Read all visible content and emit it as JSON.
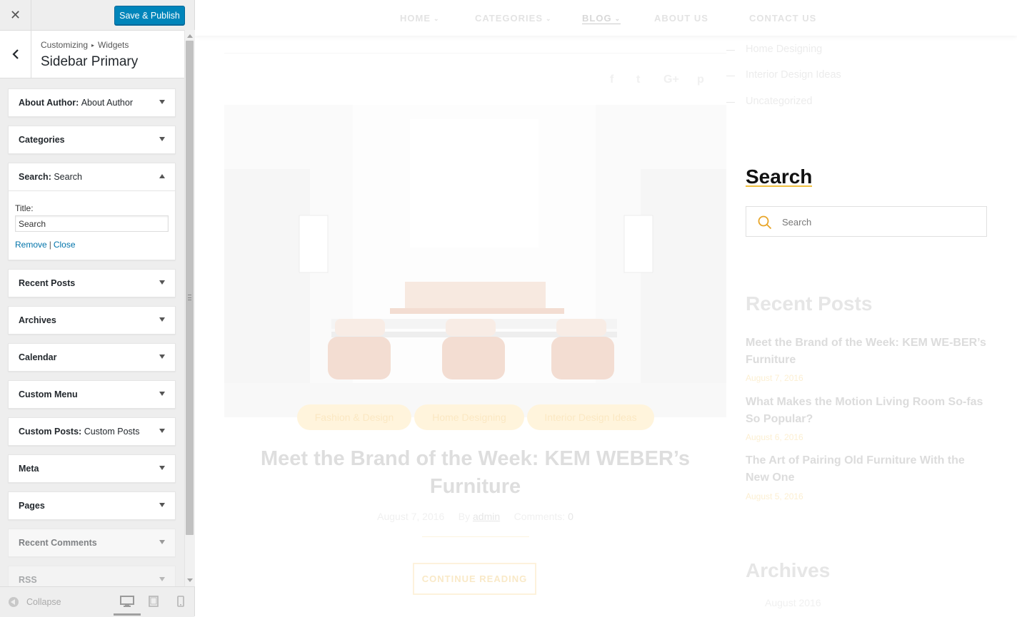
{
  "customizer": {
    "close_label": "✕",
    "save_label": "Save & Publish",
    "breadcrumb": {
      "first": "Customizing",
      "second": "Widgets"
    },
    "section_title": "Sidebar Primary",
    "widgets": [
      {
        "name": "About Author",
        "subtitle": "About Author"
      },
      {
        "name": "Categories",
        "subtitle": ""
      },
      {
        "name": "Search",
        "subtitle": "Search"
      },
      {
        "name": "Recent Posts",
        "subtitle": ""
      },
      {
        "name": "Archives",
        "subtitle": ""
      },
      {
        "name": "Calendar",
        "subtitle": ""
      },
      {
        "name": "Custom Menu",
        "subtitle": ""
      },
      {
        "name": "Custom Posts",
        "subtitle": "Custom Posts"
      },
      {
        "name": "Meta",
        "subtitle": ""
      },
      {
        "name": "Pages",
        "subtitle": ""
      },
      {
        "name": "Recent Comments",
        "subtitle": ""
      },
      {
        "name": "RSS",
        "subtitle": ""
      }
    ],
    "search_form": {
      "title_label": "Title:",
      "title_value": "Search",
      "remove_label": "Remove",
      "separator": "|",
      "close_label": "Close"
    },
    "footer": {
      "collapse_label": "Collapse"
    },
    "colors": {
      "primary_button": "#0085ba",
      "link": "#0073aa"
    }
  },
  "preview": {
    "nav": [
      "HOME",
      "CATEGORIES",
      "BLOG",
      "ABOUT US",
      "CONTACT US"
    ],
    "social_icons": [
      "facebook-icon",
      "twitter-icon",
      "google-plus-icon",
      "pinterest-icon"
    ],
    "social_glyphs": [
      "f",
      "t",
      "G+",
      "p"
    ],
    "post": {
      "categories": [
        "Fashion & Design",
        "Home Designing",
        "Interior Design Ideas"
      ],
      "title": "Meet the Brand of the Week: KEM WEBER’s Furniture",
      "date": "August 7, 2016",
      "by_label": "By",
      "author": "admin",
      "comments_label": "Comments:",
      "comments_count": "0",
      "read_more": "CONTINUE READING"
    },
    "sidebar": {
      "category_links": [
        "Home Designing",
        "Interior Design Ideas",
        "Uncategorized"
      ],
      "search_heading": "Search",
      "search_placeholder": "Search",
      "recent_heading": "Recent Posts",
      "recent_posts": [
        {
          "title": "Meet the Brand of the Week: KEM WE-BER’s Furniture",
          "date": "August 7, 2016"
        },
        {
          "title": "What Makes the Motion Living Room So-fas So Popular?",
          "date": "August 6, 2016"
        },
        {
          "title": "The Art of Pairing Old Furniture With the New One",
          "date": "August 5, 2016"
        }
      ],
      "archives_heading": "Archives",
      "archive_item": "August 2016"
    },
    "colors": {
      "accent": "#f0c040"
    }
  }
}
